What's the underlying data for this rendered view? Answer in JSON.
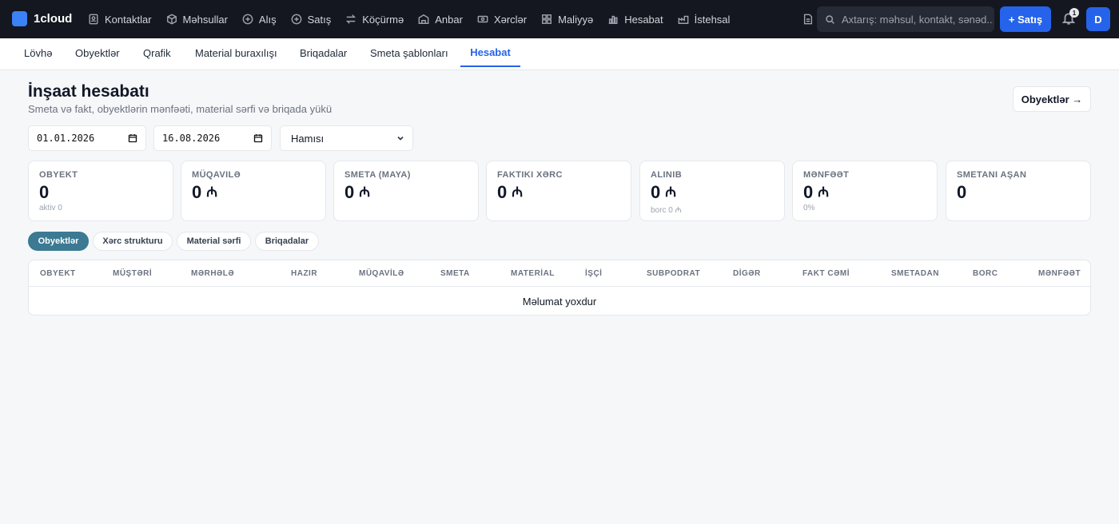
{
  "brand": {
    "name": "1cloud"
  },
  "nav": [
    {
      "label": "Kontaktlar",
      "icon": "contacts-icon"
    },
    {
      "label": "Məhsullar",
      "icon": "box-icon"
    },
    {
      "label": "Alış",
      "icon": "plus-circle-icon"
    },
    {
      "label": "Satış",
      "icon": "plus-circle-icon"
    },
    {
      "label": "Köçürmə",
      "icon": "transfer-icon"
    },
    {
      "label": "Anbar",
      "icon": "warehouse-icon"
    },
    {
      "label": "Xərclər",
      "icon": "money-icon"
    },
    {
      "label": "Maliyyə",
      "icon": "grid-icon"
    },
    {
      "label": "Hesabat",
      "icon": "bar-chart-icon"
    },
    {
      "label": "İstehsal",
      "icon": "factory-icon"
    }
  ],
  "search": {
    "placeholder": "Axtarış: məhsul, kontakt, sənəd..."
  },
  "header": {
    "sale_button": "+ Satış",
    "notification_count": "1",
    "avatar_initial": "D"
  },
  "subnav": [
    {
      "label": "Lövhə"
    },
    {
      "label": "Obyektlər"
    },
    {
      "label": "Qrafik"
    },
    {
      "label": "Material buraxılışı"
    },
    {
      "label": "Briqadalar"
    },
    {
      "label": "Smeta şablonları"
    },
    {
      "label": "Hesabat",
      "active": true
    }
  ],
  "page": {
    "title": "İnşaat hesabatı",
    "subtitle": "Smeta və fakt, obyektlərin mənfəəti, material sərfi və briqada yükü",
    "objects_button": "Obyektlər →"
  },
  "filters": {
    "date_from": "01.01.2026",
    "date_to": "16.08.2026",
    "status": "Hamısı"
  },
  "kpis": [
    {
      "label": "Obyekt",
      "value": "0",
      "currency": "",
      "sub": "aktiv 0"
    },
    {
      "label": "Müqavilə",
      "value": "0",
      "currency": "₼",
      "sub": ""
    },
    {
      "label": "Smeta (maya)",
      "value": "0",
      "currency": "₼",
      "sub": ""
    },
    {
      "label": "Faktiki xərc",
      "value": "0",
      "currency": "₼",
      "sub": ""
    },
    {
      "label": "Alınıb",
      "value": "0",
      "currency": "₼",
      "sub": "borc 0 ₼"
    },
    {
      "label": "Mənfəət",
      "value": "0",
      "currency": "₼",
      "sub": "0%"
    },
    {
      "label": "Smetanı aşan",
      "value": "0",
      "currency": "",
      "sub": ""
    }
  ],
  "tabs": [
    {
      "label": "Obyektlər",
      "active": true
    },
    {
      "label": "Xərc strukturu"
    },
    {
      "label": "Material sərfi"
    },
    {
      "label": "Briqadalar"
    }
  ],
  "table": {
    "columns": [
      "OBYEKT",
      "MÜŞTƏRİ",
      "MƏRHƏLƏ",
      "HAZIR",
      "MÜQAVİLƏ",
      "SMETA",
      "MATERİAL",
      "İŞÇİ",
      "SUBPODRAT",
      "DİGƏR",
      "FAKT CƏMİ",
      "SMETADAN",
      "BORC",
      "MƏNFƏƏT"
    ],
    "empty_text": "Məlumat yoxdur"
  }
}
